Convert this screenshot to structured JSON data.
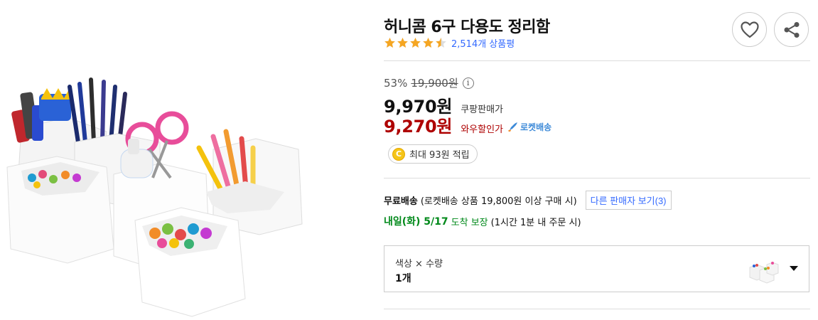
{
  "product": {
    "title": "허니콤 6구 다용도 정리함",
    "rating": 4.5,
    "review_count": "2,514개 상품평"
  },
  "price": {
    "discount_rate": "53%",
    "original_price": "19,900원",
    "info_icon": "i",
    "coupang_price": "9,970원",
    "coupang_label": "쿠팡판매가",
    "wow_price": "9,270원",
    "wow_label": "와우할인가",
    "rocket_label": "로켓배송"
  },
  "reward": {
    "coin_letter": "C",
    "text": "최대 93원 적립"
  },
  "shipping": {
    "free_label": "무료배송",
    "condition": "(로켓배송 상품 19,800원 이상 구매 시)",
    "other_sellers": "다른 판매자 보기(3)"
  },
  "arrival": {
    "day": "내일(화) 5/17",
    "guarantee": "도착 보장",
    "note": "(1시간 1분 내 주문 시)"
  },
  "option": {
    "label": "색상 × 수량",
    "value": "1개"
  },
  "icons": {
    "wishlist": "heart-icon",
    "share": "share-icon",
    "dropdown": "caret-down-icon"
  },
  "colors": {
    "star": "#f5a623",
    "link_blue": "#346aff",
    "wow_red": "#ae0000",
    "arrival_green": "#00891a",
    "rocket_blue": "#3d8ad8"
  }
}
